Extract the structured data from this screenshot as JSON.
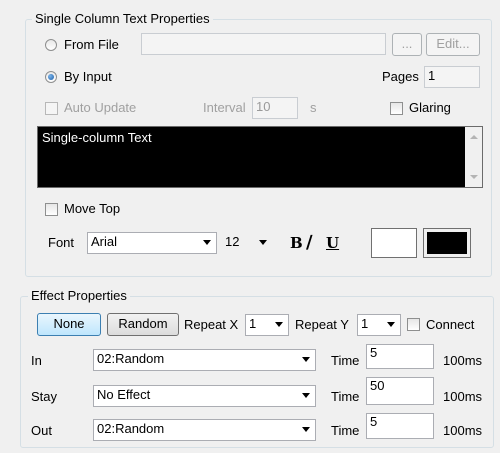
{
  "text_props": {
    "legend": "Single Column Text Properties",
    "from_file_label": "From File",
    "file_path": "",
    "browse_label": "...",
    "edit_label": "Edit...",
    "by_input_label": "By Input",
    "pages_label": "Pages",
    "pages_value": "1",
    "auto_update_label": "Auto Update",
    "interval_label": "Interval",
    "interval_value": "10",
    "interval_unit": "s",
    "glaring_label": "Glaring",
    "text_content": "Single-column Text",
    "move_top_label": "Move Top",
    "font_label": "Font",
    "font_value": "Arial",
    "size_value": "12",
    "bold_label": "B",
    "italic_label": "∕",
    "underline_label": "U",
    "fg_color": "#ffffff",
    "bg_color": "#000000"
  },
  "effect_props": {
    "legend": "Effect Properties",
    "none_label": "None",
    "random_label": "Random",
    "repeat_x_label": "Repeat X",
    "repeat_x_value": "1",
    "repeat_y_label": "Repeat Y",
    "repeat_y_value": "1",
    "connect_label": "Connect",
    "rows": [
      {
        "label": "In",
        "effect": "02:Random",
        "time_label": "Time",
        "time": "5",
        "unit": "100ms"
      },
      {
        "label": "Stay",
        "effect": "No Effect",
        "time_label": "Time",
        "time": "50",
        "unit": "100ms"
      },
      {
        "label": "Out",
        "effect": "02:Random",
        "time_label": "Time",
        "time": "5",
        "unit": "100ms"
      }
    ]
  }
}
